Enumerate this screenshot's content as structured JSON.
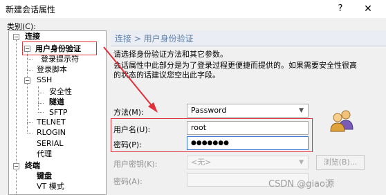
{
  "window": {
    "title": "新建会话属性",
    "help_label": "?",
    "close_label": "✕"
  },
  "category_label": "类别(C):",
  "tree": {
    "connect": "连接",
    "auth": "用户身份验证",
    "login_prompts": "登录提示符",
    "login_script": "登录脚本",
    "ssh": "SSH",
    "security": "安全性",
    "tunnel": "隧道",
    "sftp": "SFTP",
    "telnet": "TELNET",
    "rlogin": "RLOGIN",
    "serial": "SERIAL",
    "proxy": "代理",
    "terminal": "终端",
    "keyboard": "键盘",
    "vt_mode": "VT 模式"
  },
  "panel": {
    "breadcrumb": "连接 > 用户身份验证",
    "description1": "请选择身份验证方法和其它参数。",
    "description2_line1": "会话属性中此部分是为了登录过程更便捷而提供的。如果需要安全性很高",
    "description2_line2": "的状态的话建议您空出此字段。",
    "method_label": "方法(M):",
    "method_value": "Password",
    "username_label": "用户名(U):",
    "username_value": "root",
    "password_label": "密码(P):",
    "password_value": "●●●●●●●",
    "userkey_label": "用户密钥(K):",
    "userkey_value": "<无>",
    "browse_label": "浏览(B)...",
    "passphrase_label": "密码(A):"
  },
  "watermark": "CSDN @giao源",
  "icons": {
    "users": "users-icon",
    "arrow": "red-arrow-icon"
  },
  "colors": {
    "highlight": "#e0303a",
    "header_text": "#5e80a8"
  }
}
